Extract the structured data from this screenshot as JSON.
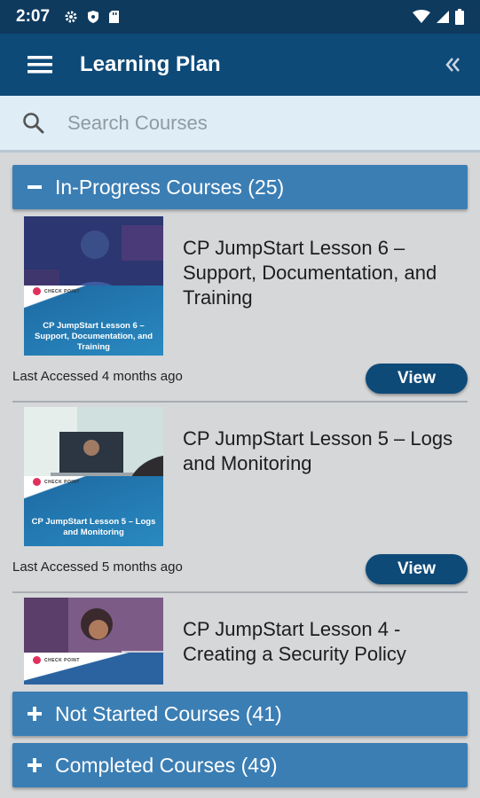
{
  "status_bar": {
    "time": "2:07"
  },
  "app_bar": {
    "title": "Learning Plan"
  },
  "search": {
    "placeholder": "Search Courses"
  },
  "sections": [
    {
      "label": "In-Progress Courses (25)",
      "state": "expanded"
    },
    {
      "label": "Not Started Courses (41)",
      "state": "collapsed"
    },
    {
      "label": "Completed Courses (49)",
      "state": "collapsed"
    }
  ],
  "courses": [
    {
      "title": "CP JumpStart Lesson 6 – Support, Documentation, and Training",
      "thumb_caption": "CP JumpStart Lesson 6 – Support, Documentation, and Training",
      "accessed": "Last Accessed 4 months ago",
      "button": "View"
    },
    {
      "title": "CP JumpStart Lesson 5 – Logs and Monitoring",
      "thumb_caption": "CP JumpStart Lesson 5 – Logs and Monitoring",
      "accessed": "Last Accessed 5 months ago",
      "button": "View"
    },
    {
      "title": "CP JumpStart Lesson 4 - Creating a Security Policy",
      "thumb_caption": "",
      "accessed": "",
      "button": ""
    }
  ],
  "thumb_brand": "CHECK POINT",
  "colors": {
    "app_bar": "#0e4a78",
    "section_header": "#3b7eb4",
    "button": "#0e4a78",
    "brand_accent": "#e0315e"
  }
}
